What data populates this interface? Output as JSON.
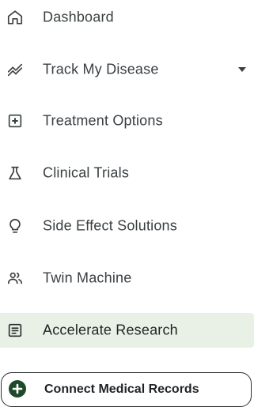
{
  "sidebar": {
    "items": [
      {
        "label": "Dashboard",
        "icon": "home-icon"
      },
      {
        "label": "Track My Disease",
        "icon": "trend-line-icon",
        "has_dropdown": true
      },
      {
        "label": "Treatment Options",
        "icon": "plus-box-icon"
      },
      {
        "label": "Clinical Trials",
        "icon": "flask-icon"
      },
      {
        "label": "Side Effect Solutions",
        "icon": "lightbulb-icon"
      },
      {
        "label": "Twin Machine",
        "icon": "people-icon"
      },
      {
        "label": "Accelerate Research",
        "icon": "document-list-icon",
        "active": true
      }
    ],
    "connect_button": {
      "label": "Connect Medical Records",
      "icon": "plus-circle-icon"
    }
  },
  "colors": {
    "text": "#3a3f42",
    "active_background": "#e9f1e6",
    "icon": "#3a3f42",
    "connect_icon": "#1f4a2a"
  }
}
